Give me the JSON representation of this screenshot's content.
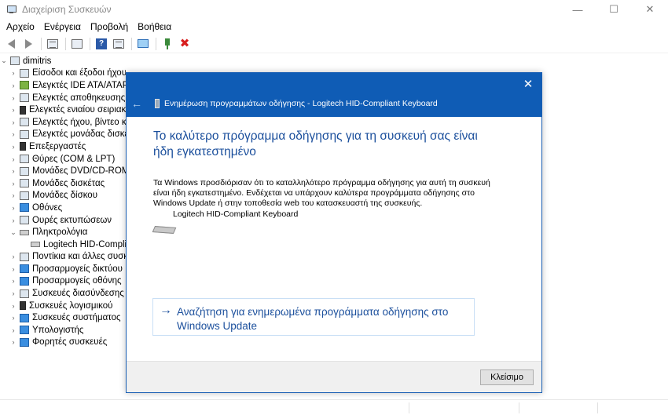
{
  "window": {
    "title": "Διαχείριση Συσκευών",
    "minimize": "—",
    "maximize": "☐",
    "close": "✕"
  },
  "menu": [
    "Αρχείο",
    "Ενέργεια",
    "Προβολή",
    "Βοήθεια"
  ],
  "tree": {
    "root": "dimitris",
    "items": [
      {
        "label": "Είσοδοι και έξοδοι ήχου",
        "chevron": "›",
        "icon": "speaker-icon"
      },
      {
        "label": "Ελεγκτές IDE ATA/ATAPI",
        "chevron": "›",
        "icon": "ide-controller-icon"
      },
      {
        "label": "Ελεγκτές αποθηκευσης",
        "chevron": "›",
        "icon": "storage-controller-icon"
      },
      {
        "label": "Ελεγκτές ενιαίου σειριακού διαύλου",
        "chevron": "›",
        "icon": "usb-icon"
      },
      {
        "label": "Ελεγκτές ήχου, βίντεο και παιχνιδιών",
        "chevron": "›",
        "icon": "sound-icon"
      },
      {
        "label": "Ελεγκτές μονάδας δισκέτας",
        "chevron": "›",
        "icon": "floppy-controller-icon"
      },
      {
        "label": "Επεξεργαστές",
        "chevron": "›",
        "icon": "cpu-icon"
      },
      {
        "label": "Θύρες (COM & LPT)",
        "chevron": "›",
        "icon": "port-icon"
      },
      {
        "label": "Μονάδες DVD/CD-ROM",
        "chevron": "›",
        "icon": "dvd-icon"
      },
      {
        "label": "Μονάδες δισκέτας",
        "chevron": "›",
        "icon": "floppy-icon"
      },
      {
        "label": "Μονάδες δίσκου",
        "chevron": "›",
        "icon": "disk-icon"
      },
      {
        "label": "Οθόνες",
        "chevron": "›",
        "icon": "monitor-icon"
      },
      {
        "label": "Ουρές εκτυπώσεων",
        "chevron": "›",
        "icon": "printer-icon"
      },
      {
        "label": "Πληκτρολόγια",
        "chevron": "⌄",
        "icon": "keyboard-icon"
      },
      {
        "label": "Logitech HID-Compliant Keyboard",
        "chevron": "",
        "icon": "keyboard-icon",
        "child": true
      },
      {
        "label": "Ποντίκια και άλλες συσκευές κατάδειξης",
        "chevron": "›",
        "icon": "mouse-icon"
      },
      {
        "label": "Προσαρμογείς δικτύου",
        "chevron": "›",
        "icon": "network-icon"
      },
      {
        "label": "Προσαρμογείς οθόνης",
        "chevron": "›",
        "icon": "display-adapter-icon"
      },
      {
        "label": "Συσκευές διασύνδεσης ανθρώπου",
        "chevron": "›",
        "icon": "hid-icon"
      },
      {
        "label": "Συσκευές λογισμικού",
        "chevron": "›",
        "icon": "software-device-icon"
      },
      {
        "label": "Συσκευές συστήματος",
        "chevron": "›",
        "icon": "system-device-icon"
      },
      {
        "label": "Υπολογιστής",
        "chevron": "›",
        "icon": "computer-icon"
      },
      {
        "label": "Φορητές συσκευές",
        "chevron": "›",
        "icon": "portable-device-icon"
      }
    ]
  },
  "dialog": {
    "caption": "Ενημέρωση προγραμμάτων οδήγησης - Logitech HID-Compliant Keyboard",
    "close": "✕",
    "back": "←",
    "heading": "Το καλύτερο πρόγραμμα οδήγησης για τη συσκευή σας είναι ήδη εγκατεστημένο",
    "message": "Τα Windows προσδιόρισαν ότι το καταλληλότερο πρόγραμμα οδήγησης για αυτή τη συσκευή είναι ήδη εγκατεστημένο. Ενδέχεται να υπάρχουν καλύτερα προγράμματα οδήγησης στο Windows Update ή στην τοποθεσία web του κατασκευαστή της συσκευής.",
    "device_name": "Logitech HID-Compliant Keyboard",
    "link_arrow": "→",
    "link_text": "Αναζήτηση για ενημερωμένα προγράμματα οδήγησης στο Windows Update",
    "close_button": "Κλείσιμο"
  }
}
